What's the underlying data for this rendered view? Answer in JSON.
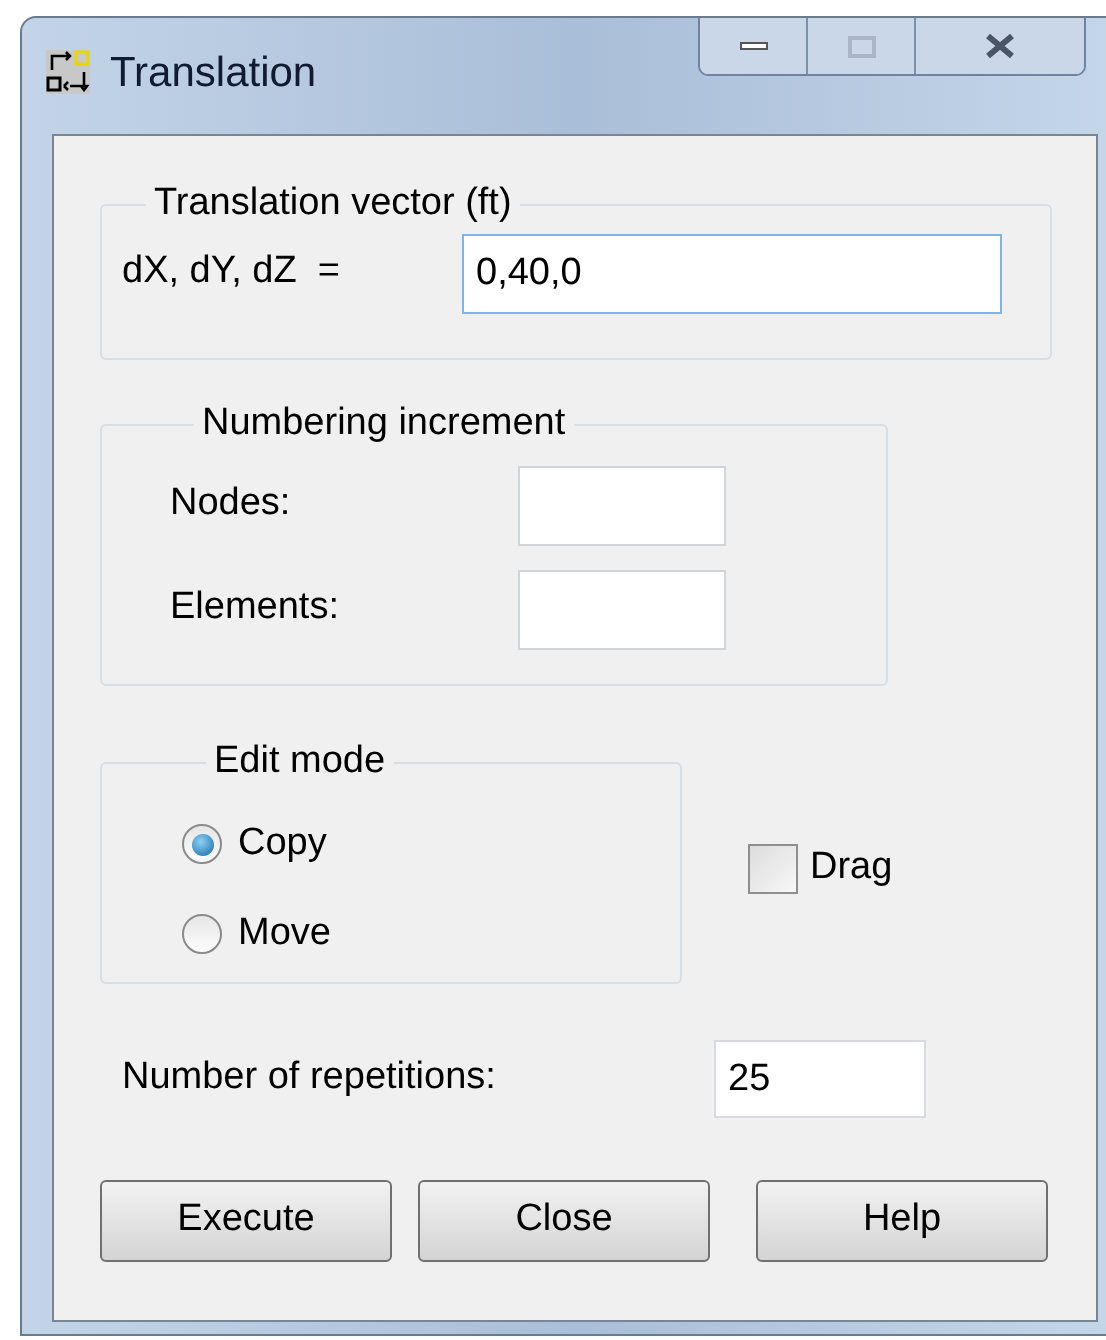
{
  "window": {
    "title": "Translation"
  },
  "translation_vector": {
    "title": "Translation vector (ft)",
    "label": "dX, dY, dZ  =",
    "value": "0,40,0"
  },
  "numbering_increment": {
    "title": "Numbering increment",
    "fields": [
      {
        "label": "Nodes:"
      },
      {
        "label": "Elements:"
      }
    ]
  },
  "edit_mode": {
    "title": "Edit mode",
    "options": [
      {
        "label": "Copy",
        "selected": true
      },
      {
        "label": "Move",
        "selected": false
      }
    ]
  },
  "drag": {
    "label": "Drag",
    "checked": false
  },
  "repetitions": {
    "label": "Number of repetitions:",
    "value": "25"
  },
  "buttons": [
    "Execute",
    "Close",
    "Help"
  ]
}
